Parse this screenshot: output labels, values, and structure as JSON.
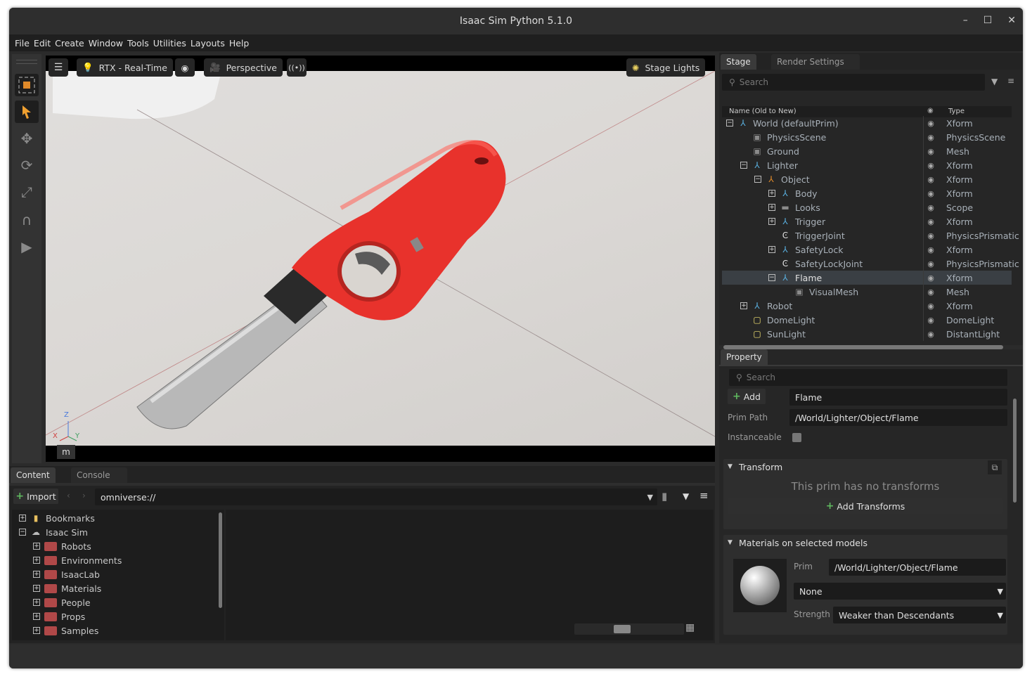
{
  "window": {
    "title": "Isaac Sim Python 5.1.0",
    "minimize": "–",
    "maximize": "☐",
    "close": "✕"
  },
  "menu": [
    "File",
    "Edit",
    "Create",
    "Window",
    "Tools",
    "Utilities",
    "Layouts",
    "Help"
  ],
  "viewport": {
    "renderer": "RTX - Real-Time",
    "camera": "Perspective",
    "lights": "Stage Lights",
    "axis_z": "Z",
    "axis_x": "X",
    "axis_y": "Y",
    "unit": "m"
  },
  "stage": {
    "tabs": [
      "Stage",
      "Render Settings"
    ],
    "search_placeholder": "Search",
    "col_name": "Name (Old to New)",
    "col_type": "Type",
    "rows": [
      {
        "name": "World (defaultPrim)",
        "type": "Xform",
        "icon": "xform",
        "expander": "−"
      },
      {
        "name": "PhysicsScene",
        "type": "PhysicsScene",
        "icon": "cube"
      },
      {
        "name": "Ground",
        "type": "Mesh",
        "icon": "cube"
      },
      {
        "name": "Lighter",
        "type": "Xform",
        "icon": "xform",
        "expander": "−"
      },
      {
        "name": "Object",
        "type": "Xform",
        "icon": "xform-orange",
        "expander": "−"
      },
      {
        "name": "Body",
        "type": "Xform",
        "icon": "xform",
        "expander": "+"
      },
      {
        "name": "Looks",
        "type": "Scope",
        "icon": "folder",
        "expander": "+"
      },
      {
        "name": "Trigger",
        "type": "Xform",
        "icon": "xform",
        "expander": "+"
      },
      {
        "name": "TriggerJoint",
        "type": "PhysicsPrismatic",
        "icon": "joint"
      },
      {
        "name": "SafetyLock",
        "type": "Xform",
        "icon": "xform",
        "expander": "+"
      },
      {
        "name": "SafetyLockJoint",
        "type": "PhysicsPrismatic",
        "icon": "joint"
      },
      {
        "name": "Flame",
        "type": "Xform",
        "icon": "xform",
        "expander": "−",
        "selected": true
      },
      {
        "name": "VisualMesh",
        "type": "Mesh",
        "icon": "cube"
      },
      {
        "name": "Robot",
        "type": "Xform",
        "icon": "xform",
        "expander": "+"
      },
      {
        "name": "DomeLight",
        "type": "DomeLight",
        "icon": "light"
      },
      {
        "name": "SunLight",
        "type": "DistantLight",
        "icon": "light"
      }
    ]
  },
  "property": {
    "tab": "Property",
    "search_placeholder": "Search",
    "add_label": "Add",
    "name_value": "Flame",
    "prim_path_label": "Prim Path",
    "prim_path_value": "/World/Lighter/Object/Flame",
    "instanceable_label": "Instanceable",
    "transform_header": "Transform",
    "no_transforms": "This prim has no transforms",
    "add_transforms": "Add Transforms",
    "materials_header": "Materials on selected models",
    "prim_label": "Prim",
    "prim_value": "/World/Lighter/Object/Flame",
    "material_value": "None",
    "strength_label": "Strength",
    "strength_value": "Weaker than Descendants"
  },
  "content": {
    "tabs": [
      "Content",
      "Console"
    ],
    "import_label": "Import",
    "path": "omniverse://",
    "tree": [
      {
        "name": "Bookmarks",
        "icon": "bookmark",
        "expander": "+"
      },
      {
        "name": "Isaac Sim",
        "icon": "cloud",
        "expander": "−"
      },
      {
        "name": "Robots",
        "icon": "folder-lock",
        "expander": "+"
      },
      {
        "name": "Environments",
        "icon": "folder-lock",
        "expander": "+"
      },
      {
        "name": "IsaacLab",
        "icon": "folder-lock",
        "expander": "+"
      },
      {
        "name": "Materials",
        "icon": "folder-lock",
        "expander": "+"
      },
      {
        "name": "People",
        "icon": "folder-lock",
        "expander": "+"
      },
      {
        "name": "Props",
        "icon": "folder-lock",
        "expander": "+"
      },
      {
        "name": "Samples",
        "icon": "folder-lock",
        "expander": "+"
      }
    ]
  },
  "colors": {
    "accent_green": "#5fb85f",
    "lighter_red": "#e8322c",
    "selected_row": "#3a3f44"
  }
}
